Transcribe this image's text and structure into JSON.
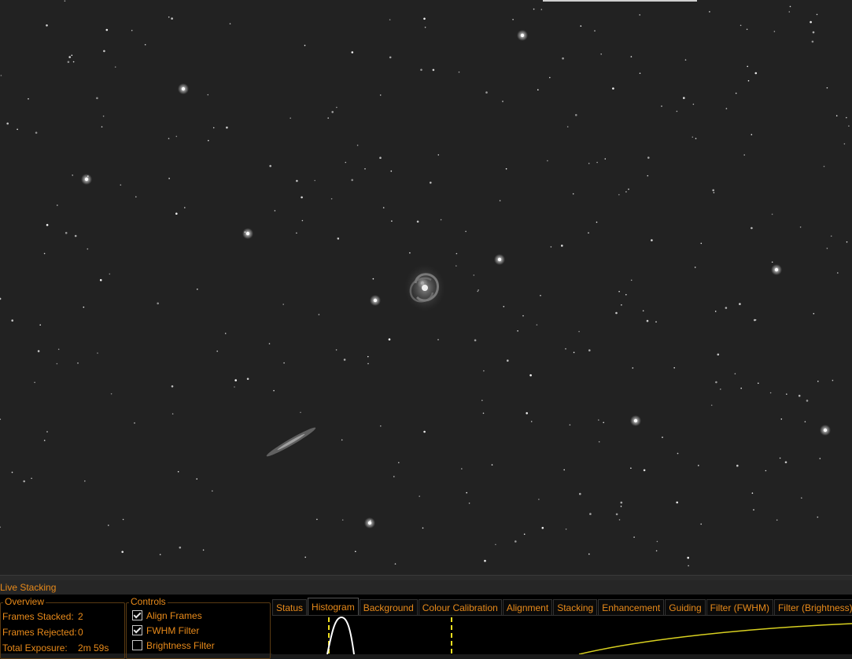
{
  "panel": {
    "title": "Live Stacking"
  },
  "overview": {
    "legend": "Overview",
    "rows": [
      {
        "label": "Frames Stacked:",
        "value": "2"
      },
      {
        "label": "Frames Rejected:",
        "value": "0"
      },
      {
        "label": "Total Exposure:",
        "value": "2m 59s"
      }
    ]
  },
  "controls": {
    "legend": "Controls",
    "items": [
      {
        "label": "Align Frames",
        "checked": true
      },
      {
        "label": "FWHM Filter",
        "checked": true
      },
      {
        "label": "Brightness Filter",
        "checked": false
      }
    ]
  },
  "tabs": [
    {
      "label": "Status",
      "active": false
    },
    {
      "label": "Histogram",
      "active": true
    },
    {
      "label": "Background",
      "active": false
    },
    {
      "label": "Colour Calibration",
      "active": false
    },
    {
      "label": "Alignment",
      "active": false
    },
    {
      "label": "Stacking",
      "active": false
    },
    {
      "label": "Enhancement",
      "active": false
    },
    {
      "label": "Guiding",
      "active": false
    },
    {
      "label": "Filter (FWHM)",
      "active": false
    },
    {
      "label": "Filter (Brightness)",
      "active": false
    }
  ],
  "colors": {
    "accent": "#e88a1a",
    "sky_background": "#222222",
    "histogram_marker": "#f0e020",
    "curve": "#d8d020"
  }
}
